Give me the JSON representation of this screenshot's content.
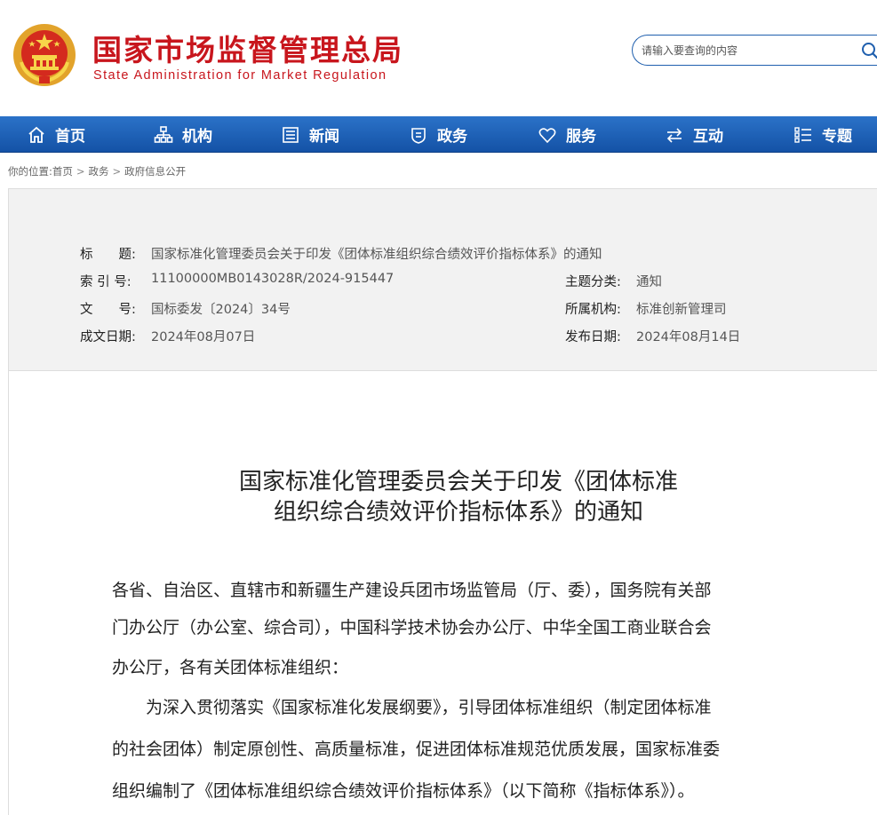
{
  "site": {
    "title_cn": "国家市场监督管理总局",
    "title_en": "State Administration for Market Regulation",
    "colors": {
      "brand_red": "#c8161d",
      "nav_blue": "#1f5fae"
    }
  },
  "search": {
    "placeholder": "请输入要查询的内容",
    "icon": "search-icon"
  },
  "nav": {
    "items": [
      {
        "label": "首页",
        "icon": "home-icon"
      },
      {
        "label": "机构",
        "icon": "org-chart-icon"
      },
      {
        "label": "新闻",
        "icon": "news-icon"
      },
      {
        "label": "政务",
        "icon": "government-icon"
      },
      {
        "label": "服务",
        "icon": "heart-icon"
      },
      {
        "label": "互动",
        "icon": "exchange-icon"
      },
      {
        "label": "专题",
        "icon": "list-icon"
      }
    ]
  },
  "breadcrumb": {
    "prefix": "你的位置:",
    "items": [
      "首页",
      "政务",
      "政府信息公开"
    ],
    "separator": ">"
  },
  "info": {
    "title_label": "标　　题:",
    "title_value": "国家标准化管理委员会关于印发《团体标准组织综合绩效评价指标体系》的通知",
    "index_label": "索 引 号:",
    "index_value": "11100000MB0143028R/2024-915447",
    "topic_label": "主题分类:",
    "topic_value": "通知",
    "docno_label": "文　　号:",
    "docno_value": "国标委发〔2024〕34号",
    "org_label": "所属机构:",
    "org_value": "标准创新管理司",
    "written_label": "成文日期:",
    "written_value": "2024年08月07日",
    "published_label": "发布日期:",
    "published_value": "2024年08月14日"
  },
  "document": {
    "title_line1": "国家标准化管理委员会关于印发《团体标准",
    "title_line2": "组织综合绩效评价指标体系》的通知",
    "lines": [
      "各省、自治区、直辖市和新疆生产建设兵团市场监管局（厅、委），国务院有关部",
      "门办公厅（办公室、综合司），中国科学技术协会办公厅、中华全国工商业联合会",
      "办公厅，各有关团体标准组织：",
      "　　为深入贯彻落实《国家标准化发展纲要》，引导团体标准组织（制定团体标准",
      "的社会团体）制定原创性、高质量标准，促进团体标准规范优质发展，国家标准委",
      "组织编制了《团体标准组织综合绩效评价指标体系》（以下简称《指标体系》）。"
    ]
  }
}
